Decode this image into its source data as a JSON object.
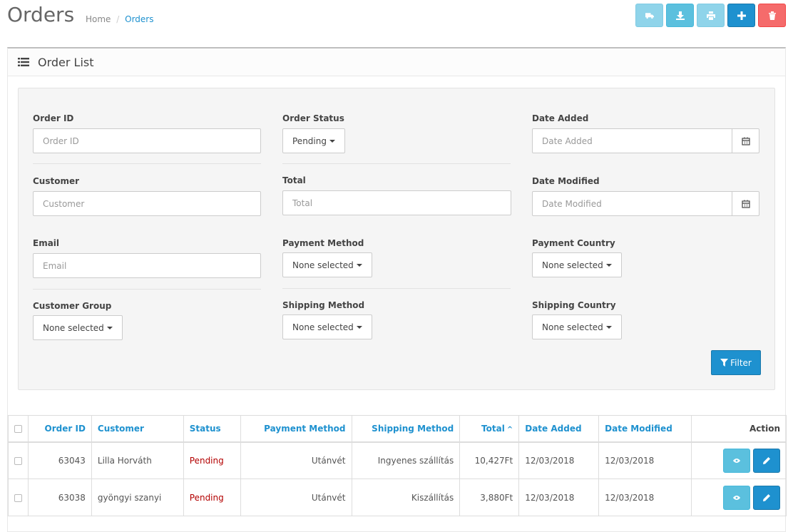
{
  "header": {
    "title": "Orders",
    "breadcrumb": [
      {
        "label": "Home"
      },
      {
        "label": "Orders"
      }
    ],
    "buttons": [
      {
        "name": "shipping-button",
        "icon": "truck-icon",
        "color": "#8fd4ea"
      },
      {
        "name": "download-button",
        "icon": "download-icon",
        "color": "#5bc0de"
      },
      {
        "name": "print-button",
        "icon": "print-icon",
        "color": "#8fd4ea"
      },
      {
        "name": "add-button",
        "icon": "plus-icon",
        "color": "#1e91cf"
      },
      {
        "name": "delete-button",
        "icon": "trash-icon",
        "color": "#f56b6b"
      }
    ]
  },
  "panel": {
    "title": "Order List",
    "icon": "list-icon"
  },
  "filter": {
    "order_id": {
      "label": "Order ID",
      "placeholder": "Order ID",
      "value": ""
    },
    "order_status": {
      "label": "Order Status",
      "value": "Pending"
    },
    "date_added": {
      "label": "Date Added",
      "placeholder": "Date Added",
      "value": ""
    },
    "customer": {
      "label": "Customer",
      "placeholder": "Customer",
      "value": ""
    },
    "total": {
      "label": "Total",
      "placeholder": "Total",
      "value": ""
    },
    "date_modified": {
      "label": "Date Modified",
      "placeholder": "Date Modified",
      "value": ""
    },
    "email": {
      "label": "Email",
      "placeholder": "Email",
      "value": ""
    },
    "payment_method": {
      "label": "Payment Method",
      "value": "None selected"
    },
    "payment_country": {
      "label": "Payment Country",
      "value": "None selected"
    },
    "customer_group": {
      "label": "Customer Group",
      "value": "None selected"
    },
    "shipping_method": {
      "label": "Shipping Method",
      "value": "None selected"
    },
    "shipping_country": {
      "label": "Shipping Country",
      "value": "None selected"
    },
    "filter_button": "Filter"
  },
  "table": {
    "columns": {
      "order_id": "Order ID",
      "customer": "Customer",
      "status": "Status",
      "payment_method": "Payment Method",
      "shipping_method": "Shipping Method",
      "total": "Total",
      "date_added": "Date Added",
      "date_modified": "Date Modified",
      "action": "Action"
    },
    "rows": [
      {
        "order_id": "63043",
        "customer": "Lilla Horváth",
        "status": "Pending",
        "payment_method": "Utánvét",
        "shipping_method": "Ingyenes szállítás",
        "total": "10,427Ft",
        "date_added": "12/03/2018",
        "date_modified": "12/03/2018"
      },
      {
        "order_id": "63038",
        "customer": "gyöngyi szanyi",
        "status": "Pending",
        "payment_method": "Utánvét",
        "shipping_method": "Kiszállítás",
        "total": "3,880Ft",
        "date_added": "12/03/2018",
        "date_modified": "12/03/2018"
      }
    ]
  }
}
